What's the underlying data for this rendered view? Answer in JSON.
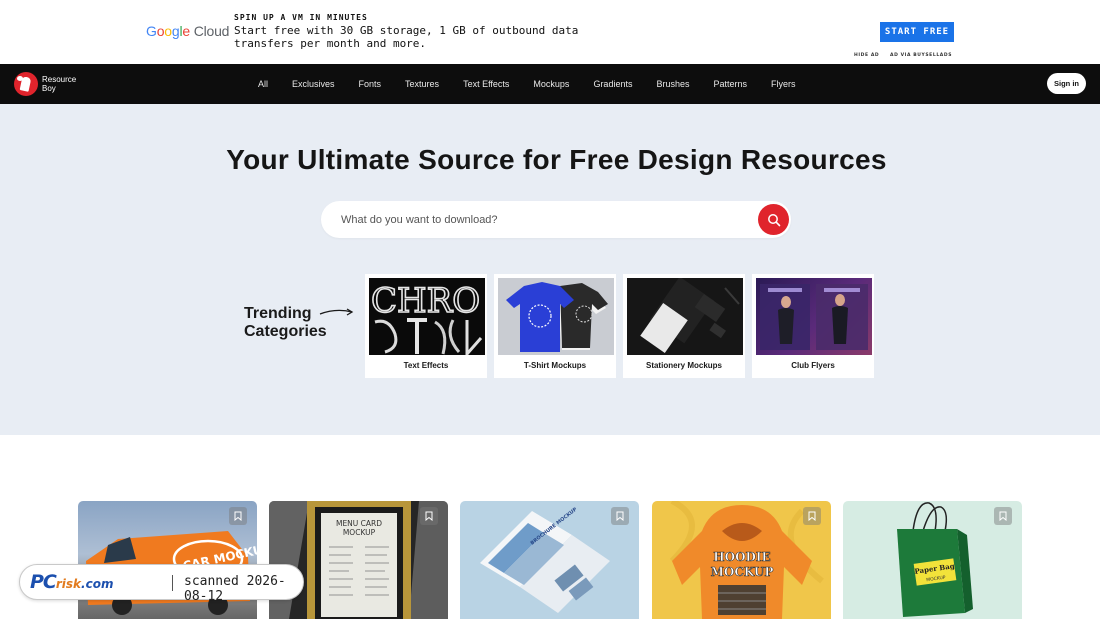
{
  "ad": {
    "logo": "Google Cloud",
    "kicker": "SPIN UP A VM IN MINUTES",
    "text": "Start free with 30 GB storage, 1 GB of outbound data transfers per month and more.",
    "cta": "START FREE",
    "hide": "HIDE AD",
    "via": "AD VIA BUYSELLADS"
  },
  "brand": {
    "line1": "Resource",
    "line2": "Boy"
  },
  "nav": {
    "links": [
      "All",
      "Exclusives",
      "Fonts",
      "Textures",
      "Text Effects",
      "Mockups",
      "Gradients",
      "Brushes",
      "Patterns",
      "Flyers"
    ],
    "signin": "Sign in"
  },
  "hero": {
    "title": "Your Ultimate Source for Free Design Resources",
    "search_placeholder": "What do you want to download?",
    "trending_line1": "Trending",
    "trending_line2": "Categories"
  },
  "categories": [
    {
      "label": "Text Effects",
      "image_text": "CHRO"
    },
    {
      "label": "T-Shirt Mockups"
    },
    {
      "label": "Stationery Mockups"
    },
    {
      "label": "Club Flyers"
    }
  ],
  "cards": [
    {
      "image_text": "CAR MOCKUP",
      "color": "#f07a1f"
    },
    {
      "image_text_line1": "MENU CARD",
      "image_text_line2": "MOCKUP",
      "color": "#2a2a2a"
    },
    {
      "image_text": "BROCHURE MOCKUP",
      "color": "#b9d3e4"
    },
    {
      "image_text_line1": "HOODIE",
      "image_text_line2": "MOCKUP",
      "color": "#f0c64a"
    },
    {
      "image_text_line1": "Paper Bag",
      "image_text_line2": "MOCKUP",
      "color": "#d6ece3"
    }
  ],
  "watermark": {
    "logo_pc": "PC",
    "logo_risk": "risk",
    "logo_com": ".com",
    "text": "scanned 2026-08-12"
  },
  "colors": {
    "accent": "#e0242c",
    "nav_bg": "#0d0d0d",
    "hero_bg": "#e8edf4",
    "ad_cta": "#1a73e8"
  }
}
